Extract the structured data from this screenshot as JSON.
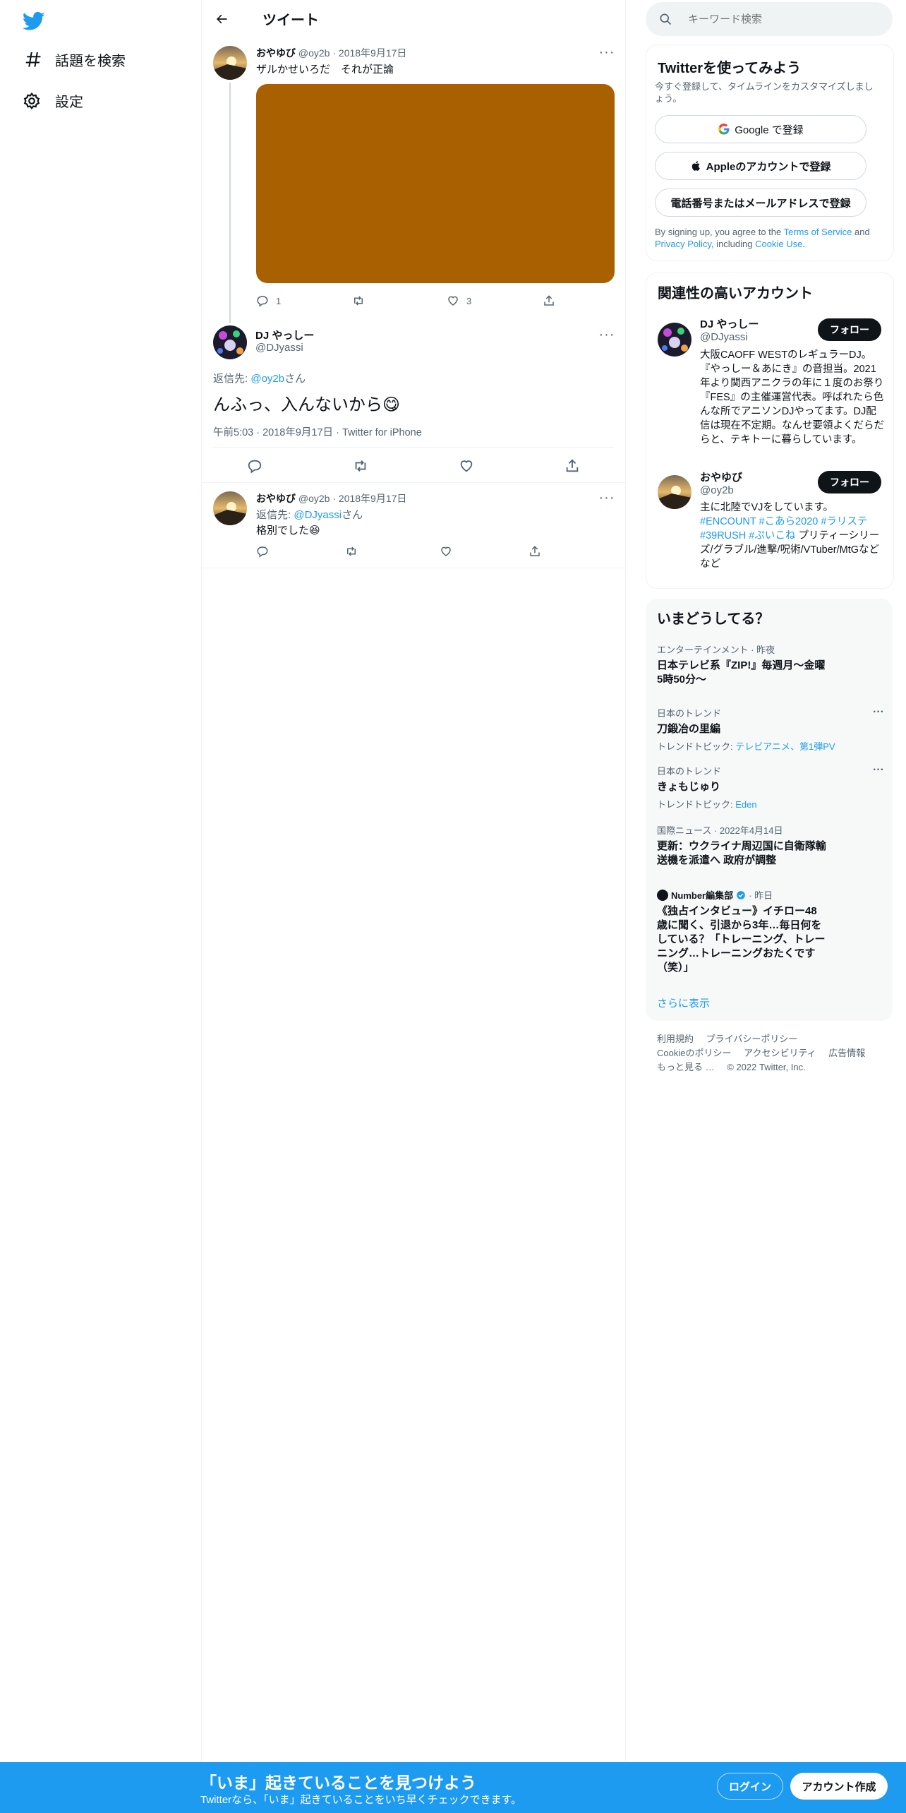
{
  "nav": {
    "explore_label": "話題を検索",
    "settings_label": "設定"
  },
  "header": {
    "title": "ツイート"
  },
  "tweet1": {
    "name": "おやゆび",
    "handle_date": "@oy2b · 2018年9月17日",
    "text": "ザルかせいろだ　それが正論",
    "media_color": "#a96000",
    "reply_count": "1",
    "like_count": "3"
  },
  "main_tweet": {
    "name": "DJ やっしー",
    "handle": "@DJyassi",
    "reply_prefix": "返信先: ",
    "reply_to": "@oy2b",
    "reply_suffix": "さん",
    "text": "んふっ、入んないから😋",
    "meta": "午前5:03 · 2018年9月17日 · Twitter for iPhone"
  },
  "tweet3": {
    "name": "おやゆび",
    "handle_date": "@oy2b · 2018年9月17日",
    "reply_prefix": "返信先: ",
    "reply_to": "@DJyassi",
    "reply_suffix": "さん",
    "text": "格別でした😆"
  },
  "search": {
    "placeholder": "キーワード検索"
  },
  "signup_card": {
    "title": "Twitterを使ってみよう",
    "subtitle": "今すぐ登録して、タイムラインをカスタマイズしましょう。",
    "google_label": "Google で登録",
    "apple_label": "Appleのアカウントで登録",
    "phone_label": "電話番号またはメールアドレスで登録",
    "terms_1": "By signing up, you agree to the ",
    "terms_link1": "Terms of Service",
    "terms_2": " and ",
    "terms_link2": "Privacy Policy",
    "terms_3": ", including ",
    "terms_link3": "Cookie Use",
    "terms_4": "."
  },
  "relevant": {
    "title": "関連性の高いアカウント",
    "follow_label": "フォロー",
    "accounts": [
      {
        "name": "DJ やっしー",
        "handle": "@DJyassi",
        "bio": "大阪CAOFF WESTのレギュラーDJ。『やっしー＆あにき』の音担当。2021年より関西アニクラの年に１度のお祭り『FES』の主催運営代表。呼ばれたら色んな所でアニソンDJやってます。DJ配信は現在不定期。なんせ要領よくだらだらと、テキトーに暮らしています。"
      },
      {
        "name": "おやゆび",
        "handle": "@oy2b",
        "bio_text1": "主に北陸でVJをしています。",
        "bio_tags1": "#ENCOUNT #こあら2020 #ラリステ #39RUSH #ぷいこね",
        "bio_text2": " プリティーシリーズ/グラブル/進撃/呪術/VTuber/MtGなどなど"
      }
    ]
  },
  "trends": {
    "title": "いまどうしてる？",
    "items": [
      {
        "context": "エンターテインメント · 昨夜",
        "title": "日本テレビ系『ZIP!』毎週月〜金曜 5時50分〜",
        "topic": ""
      },
      {
        "context": "日本のトレンド",
        "title": "刀鍛冶の里編",
        "topic_prefix": "トレンドトピック: ",
        "topic": "テレビアニメ、第1弾PV"
      },
      {
        "context": "日本のトレンド",
        "title": "きょもじゅり",
        "topic_prefix": "トレンドトピック: ",
        "topic": "Eden"
      },
      {
        "context": "国際ニュース · 2022年4月14日",
        "title": "更新：ウクライナ周辺国に自衛隊輸送機を派遣へ 政府が調整",
        "topic": ""
      },
      {
        "context_name": "Number編集部",
        "context_time": " · 昨日",
        "title": "《独占インタビュー》イチロー48歳に聞く、引退から3年…毎日何をしている？「トレーニング、トレーニング…トレーニングおたくです（笑）」",
        "topic": ""
      }
    ],
    "show_more": "さらに表示"
  },
  "footer": {
    "links": [
      "利用規約",
      "プライバシーポリシー",
      "Cookieのポリシー",
      "アクセシビリティ",
      "広告情報",
      "もっと見る …"
    ],
    "copyright": "© 2022 Twitter, Inc."
  },
  "banner": {
    "title": "「いま」起きていることを見つけよう",
    "subtitle": "Twitterなら、「いま」起きていることをいち早くチェックできます。",
    "login_label": "ログイン",
    "signup_label": "アカウント作成"
  },
  "colors": {
    "brand": "#1d9bf0",
    "banner_bg": "#1d9bf0",
    "media": "#a96000"
  }
}
